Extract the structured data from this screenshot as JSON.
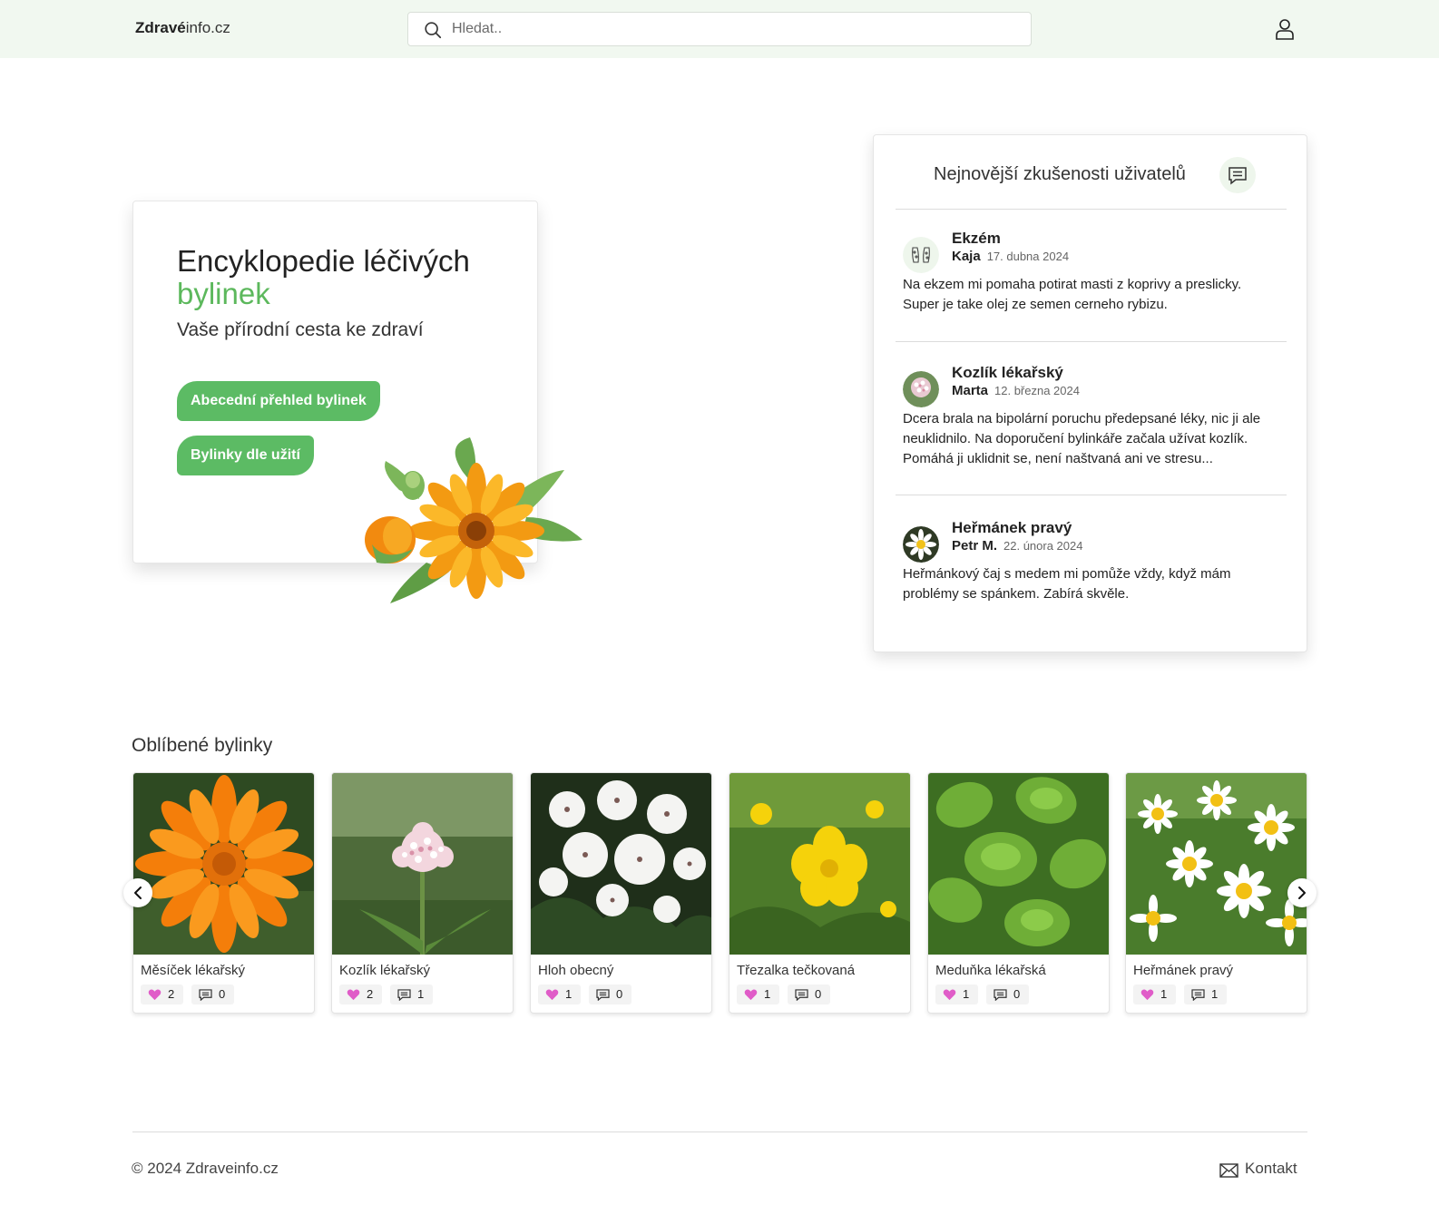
{
  "header": {
    "logo_bold": "Zdravé",
    "logo_rest": "info.cz",
    "search_placeholder": "Hledat.."
  },
  "hero": {
    "title_line1": "Encyklopedie léčivých",
    "title_line2": "bylinek",
    "subtitle": "Vaše přírodní cesta ke zdraví",
    "button_alphabetical": "Abecední přehled bylinek",
    "button_by_use": "Bylinky dle užití"
  },
  "testimonials": {
    "title": "Nejnovější zkušenosti uživatelů",
    "items": [
      {
        "topic": "Ekzém",
        "user": "Kaja",
        "date": "17. dubna 2024",
        "text": "Na ekzem mi pomaha potirat masti z koprivy a preslicky. Super je take olej ze semen cerneho rybizu."
      },
      {
        "topic": "Kozlík lékařský",
        "user": "Marta",
        "date": "12. března 2024",
        "text": "Dcera brala na bipolární poruchu předepsané léky, nic ji ale neuklidnilo. Na doporučení bylinkáře začala užívat kozlík. Pomáhá ji uklidnit se, není naštvaná ani ve stresu..."
      },
      {
        "topic": "Heřmánek pravý",
        "user": "Petr M.",
        "date": "22. února 2024",
        "text": "Heřmánkový čaj s medem mi pomůže vždy, když mám problémy se spánkem. Zabírá skvěle."
      }
    ]
  },
  "favorites": {
    "title": "Oblíbené bylinky",
    "items": [
      {
        "name": "Měsíček lékařský",
        "likes": "2",
        "comments": "0"
      },
      {
        "name": "Kozlík lékařský",
        "likes": "2",
        "comments": "1"
      },
      {
        "name": "Hloh obecný",
        "likes": "1",
        "comments": "0"
      },
      {
        "name": "Třezalka tečkovaná",
        "likes": "1",
        "comments": "0"
      },
      {
        "name": "Meduňka lékařská",
        "likes": "1",
        "comments": "0"
      },
      {
        "name": "Heřmánek pravý",
        "likes": "1",
        "comments": "1"
      }
    ]
  },
  "footer": {
    "copyright": "© 2024 Zdraveinfo.cz",
    "contact": "Kontakt"
  },
  "colors": {
    "accent_green": "#5cbb64",
    "header_bg": "#f1f8f0",
    "heart": "#e05cc8"
  }
}
